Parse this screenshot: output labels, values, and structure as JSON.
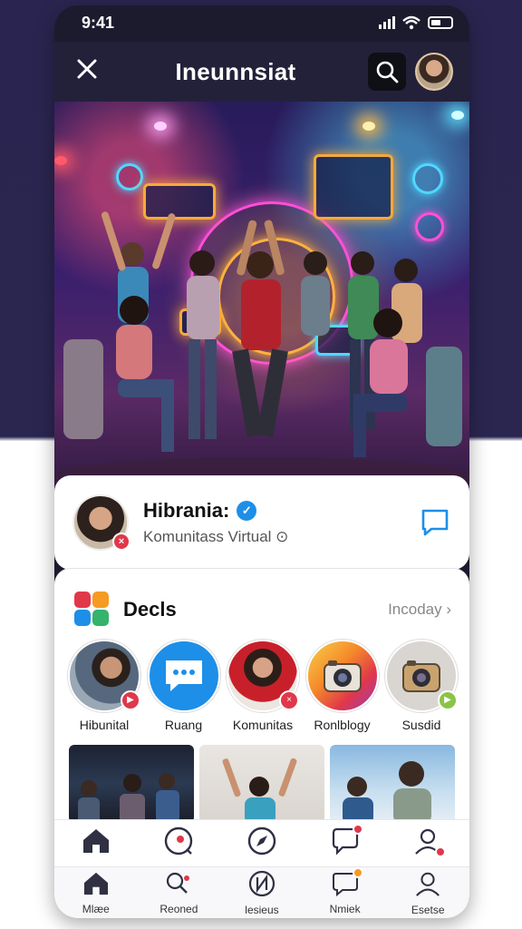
{
  "status": {
    "time": "9:41"
  },
  "header": {
    "title": "Ineunnsiat"
  },
  "profile": {
    "name": "Hibrania:",
    "subtitle": "Komunitass Virtual ⊙"
  },
  "section": {
    "title": "Decls",
    "more_label": "Incoday ›",
    "stories": [
      {
        "label": "Hibunital",
        "badge_color": "#e0384a",
        "icon": "camera-person"
      },
      {
        "label": "Ruang",
        "badge_color": "",
        "icon": "chat-bubble"
      },
      {
        "label": "Komunitas",
        "badge_color": "#e0384a",
        "icon": "woman-portrait"
      },
      {
        "label": "Ronlblogy",
        "badge_color": "",
        "icon": "instagram-camera"
      },
      {
        "label": "Susdid",
        "badge_color": "#8bc34a",
        "icon": "instagram-camera"
      }
    ]
  },
  "nav_top": [
    {
      "icon": "home-icon"
    },
    {
      "icon": "record-icon"
    },
    {
      "icon": "compass-icon"
    },
    {
      "icon": "heart-chat-icon"
    },
    {
      "icon": "user-icon"
    }
  ],
  "nav_bottom": [
    {
      "icon": "home-icon",
      "label": "Mlæe"
    },
    {
      "icon": "search-people-icon",
      "label": "Reoned"
    },
    {
      "icon": "lightning-icon",
      "label": "lesieus"
    },
    {
      "icon": "message-icon",
      "label": "Nmiek"
    },
    {
      "icon": "user-icon",
      "label": "Esetse"
    }
  ],
  "colors": {
    "accent": "#1d8fe8",
    "badge_red": "#e0384a",
    "badge_orange": "#f59b23"
  }
}
